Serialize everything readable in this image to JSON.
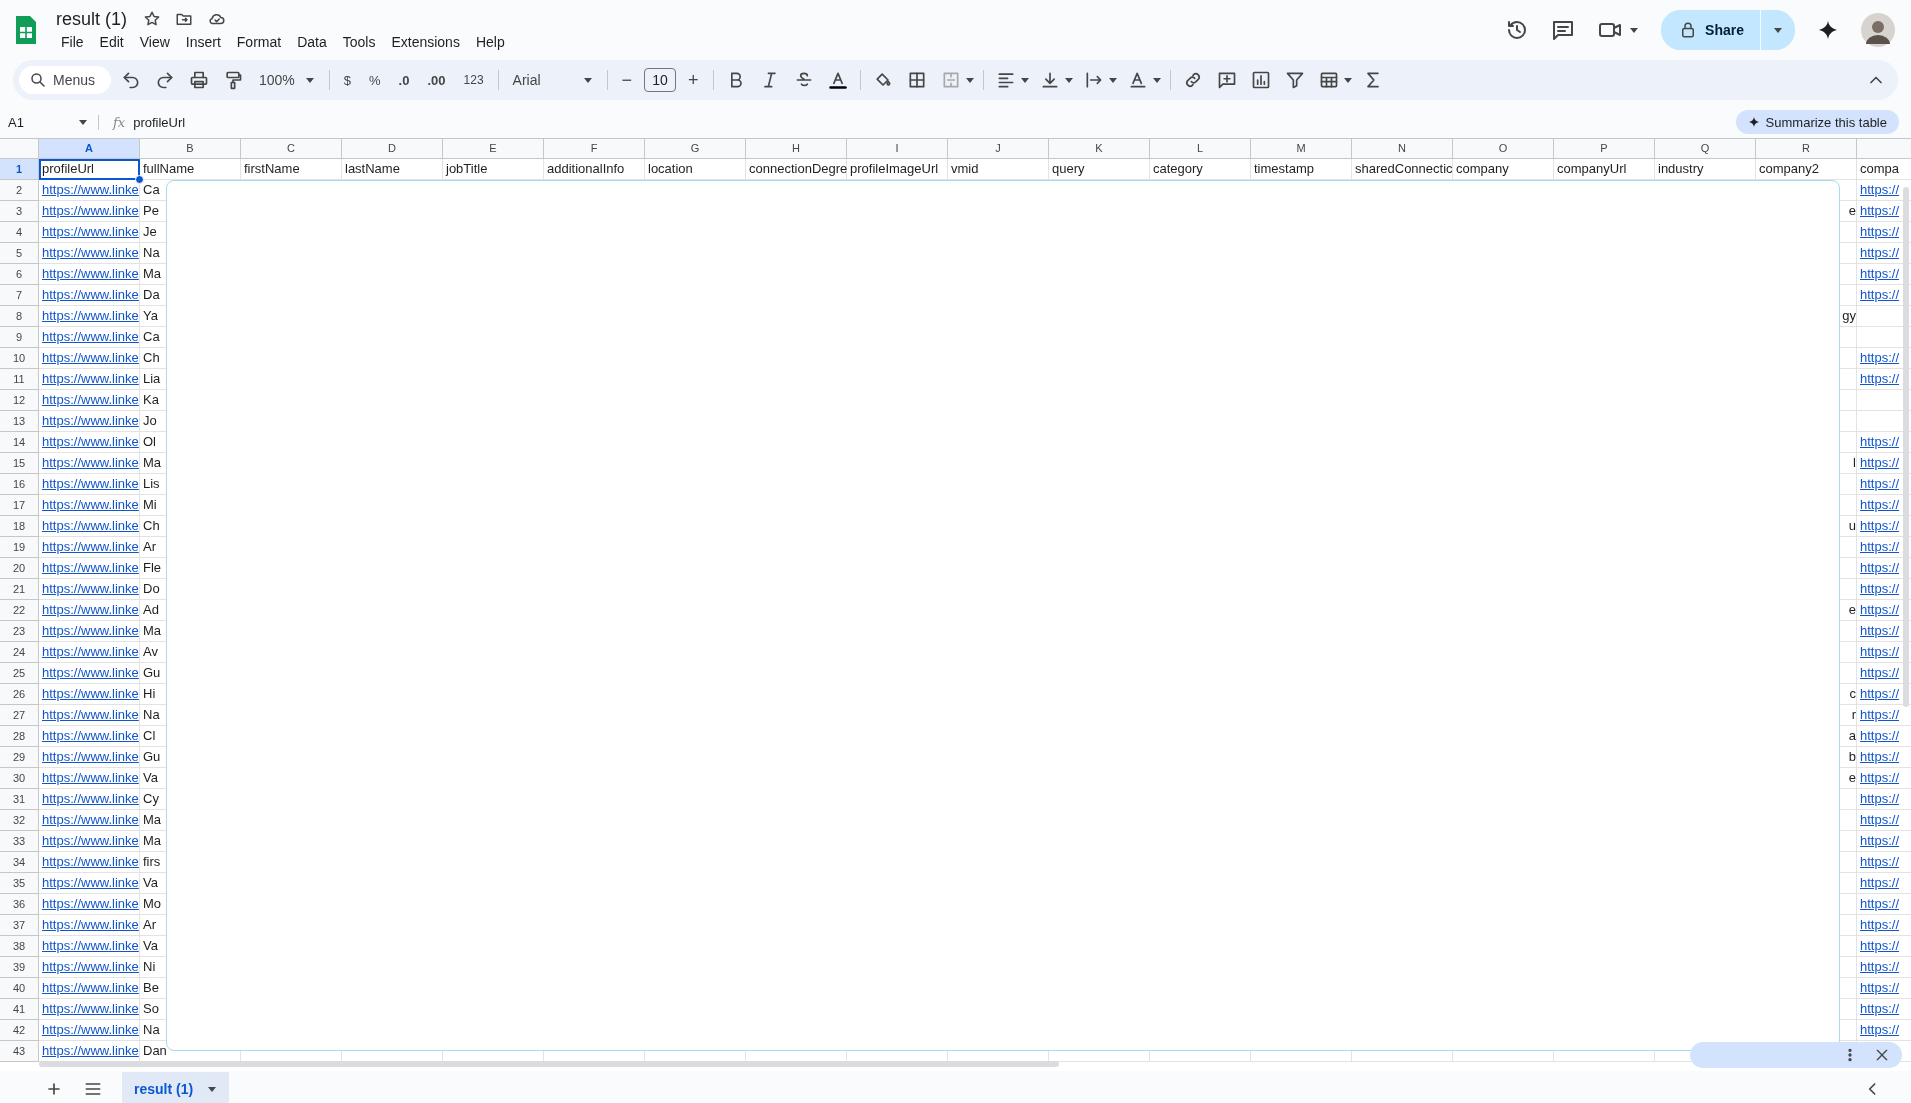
{
  "document": {
    "title": "result (1)"
  },
  "menu": [
    "File",
    "Edit",
    "View",
    "Insert",
    "Format",
    "Data",
    "Tools",
    "Extensions",
    "Help"
  ],
  "share": {
    "label": "Share"
  },
  "toolbar": {
    "search_placeholder": "Menus",
    "zoom": "100%",
    "currency": "$",
    "percent": "%",
    "decrease_decimals": ".0",
    "increase_decimals": ".00",
    "number_format": "123",
    "font": "Arial",
    "font_size": "10",
    "minus": "−",
    "plus": "+"
  },
  "formula_bar": {
    "cell": "A1",
    "function_label": "fx",
    "value": "profileUrl",
    "summarize": "Summarize this table"
  },
  "columns": [
    {
      "letter": "A",
      "selected": true
    },
    {
      "letter": "B",
      "selected": false
    },
    {
      "letter": "C",
      "selected": false
    },
    {
      "letter": "D",
      "selected": false
    },
    {
      "letter": "E",
      "selected": false
    },
    {
      "letter": "F",
      "selected": false
    },
    {
      "letter": "G",
      "selected": false
    },
    {
      "letter": "H",
      "selected": false
    },
    {
      "letter": "I",
      "selected": false
    },
    {
      "letter": "J",
      "selected": false
    },
    {
      "letter": "K",
      "selected": false
    },
    {
      "letter": "L",
      "selected": false
    },
    {
      "letter": "M",
      "selected": false
    },
    {
      "letter": "N",
      "selected": false
    },
    {
      "letter": "O",
      "selected": false
    },
    {
      "letter": "P",
      "selected": false
    },
    {
      "letter": "Q",
      "selected": false
    },
    {
      "letter": "R",
      "selected": false
    }
  ],
  "header_row": {
    "number": "1",
    "selected": true,
    "cells": [
      "profileUrl",
      "fullName",
      "firstName",
      "lastName",
      "jobTitle",
      "additionalInfo",
      "location",
      "connectionDegre",
      "profileImageUrl",
      "vmid",
      "query",
      "category",
      "timestamp",
      "sharedConnectic",
      "company",
      "companyUrl",
      "industry",
      "company2",
      "compa"
    ]
  },
  "rows": [
    {
      "number": "2",
      "a": "https://www.linke",
      "b": "Ca",
      "r": "",
      "s": "https://"
    },
    {
      "number": "3",
      "a": "https://www.linke",
      "b": "Pe",
      "r": "e",
      "s": "https://"
    },
    {
      "number": "4",
      "a": "https://www.linke",
      "b": "Je",
      "r": "",
      "s": "https://"
    },
    {
      "number": "5",
      "a": "https://www.linke",
      "b": "Na",
      "r": "",
      "s": "https://"
    },
    {
      "number": "6",
      "a": "https://www.linke",
      "b": "Ma",
      "r": "",
      "s": "https://"
    },
    {
      "number": "7",
      "a": "https://www.linke",
      "b": "Da",
      "r": "",
      "s": "https://"
    },
    {
      "number": "8",
      "a": "https://www.linke",
      "b": "Ya",
      "r": "gy",
      "s": ""
    },
    {
      "number": "9",
      "a": "https://www.linke",
      "b": "Ca",
      "r": "",
      "s": ""
    },
    {
      "number": "10",
      "a": "https://www.linke",
      "b": "Ch",
      "r": "",
      "s": "https://"
    },
    {
      "number": "11",
      "a": "https://www.linke",
      "b": "Lia",
      "r": "",
      "s": "https://"
    },
    {
      "number": "12",
      "a": "https://www.linke",
      "b": "Ka",
      "r": "",
      "s": ""
    },
    {
      "number": "13",
      "a": "https://www.linke",
      "b": "Jo",
      "r": "",
      "s": ""
    },
    {
      "number": "14",
      "a": "https://www.linke",
      "b": "Ol",
      "r": "",
      "s": "https://"
    },
    {
      "number": "15",
      "a": "https://www.linke",
      "b": "Ma",
      "r": "l",
      "s": "https://"
    },
    {
      "number": "16",
      "a": "https://www.linke",
      "b": "Lis",
      "r": "",
      "s": "https://"
    },
    {
      "number": "17",
      "a": "https://www.linke",
      "b": "Mi",
      "r": "",
      "s": "https://"
    },
    {
      "number": "18",
      "a": "https://www.linke",
      "b": "Ch",
      "r": "u",
      "s": "https://"
    },
    {
      "number": "19",
      "a": "https://www.linke",
      "b": "Ar",
      "r": "",
      "s": "https://"
    },
    {
      "number": "20",
      "a": "https://www.linke",
      "b": "Fle",
      "r": "",
      "s": "https://"
    },
    {
      "number": "21",
      "a": "https://www.linke",
      "b": "Do",
      "r": "",
      "s": "https://"
    },
    {
      "number": "22",
      "a": "https://www.linke",
      "b": "Ad",
      "r": "e",
      "s": "https://"
    },
    {
      "number": "23",
      "a": "https://www.linke",
      "b": "Ma",
      "r": "",
      "s": "https://"
    },
    {
      "number": "24",
      "a": "https://www.linke",
      "b": "Av",
      "r": "",
      "s": "https://"
    },
    {
      "number": "25",
      "a": "https://www.linke",
      "b": "Gu",
      "r": "",
      "s": "https://"
    },
    {
      "number": "26",
      "a": "https://www.linke",
      "b": "Hi",
      "r": "c",
      "s": "https://"
    },
    {
      "number": "27",
      "a": "https://www.linke",
      "b": "Na",
      "r": "r",
      "s": "https://"
    },
    {
      "number": "28",
      "a": "https://www.linke",
      "b": "Cl",
      "r": "a",
      "s": "https://"
    },
    {
      "number": "29",
      "a": "https://www.linke",
      "b": "Gu",
      "r": "b",
      "s": "https://"
    },
    {
      "number": "30",
      "a": "https://www.linke",
      "b": "Va",
      "r": "e",
      "s": "https://"
    },
    {
      "number": "31",
      "a": "https://www.linke",
      "b": "Cy",
      "r": "",
      "s": "https://"
    },
    {
      "number": "32",
      "a": "https://www.linke",
      "b": "Ma",
      "r": "",
      "s": "https://"
    },
    {
      "number": "33",
      "a": "https://www.linke",
      "b": "Ma",
      "r": "",
      "s": "https://"
    },
    {
      "number": "34",
      "a": "https://www.linke",
      "b": "firs",
      "r": "",
      "s": "https://"
    },
    {
      "number": "35",
      "a": "https://www.linke",
      "b": "Va",
      "r": "",
      "s": "https://"
    },
    {
      "number": "36",
      "a": "https://www.linke",
      "b": "Mo",
      "r": "",
      "s": "https://"
    },
    {
      "number": "37",
      "a": "https://www.linke",
      "b": "Ar",
      "r": "",
      "s": "https://"
    },
    {
      "number": "38",
      "a": "https://www.linke",
      "b": "Va",
      "r": "",
      "s": "https://"
    },
    {
      "number": "39",
      "a": "https://www.linke",
      "b": "Ni",
      "r": "",
      "s": "https://"
    },
    {
      "number": "40",
      "a": "https://www.linke",
      "b": "Be",
      "r": "",
      "s": "https://"
    },
    {
      "number": "41",
      "a": "https://www.linke",
      "b": "So",
      "r": "",
      "s": "https://"
    },
    {
      "number": "42",
      "a": "https://www.linke",
      "b": "Na",
      "r": "",
      "s": "https://"
    },
    {
      "number": "43",
      "a": "https://www.linke",
      "b": "Dan",
      "r": "",
      "s": ""
    }
  ],
  "sheet_tabs": [
    {
      "label": "result (1)",
      "selected": true
    }
  ]
}
